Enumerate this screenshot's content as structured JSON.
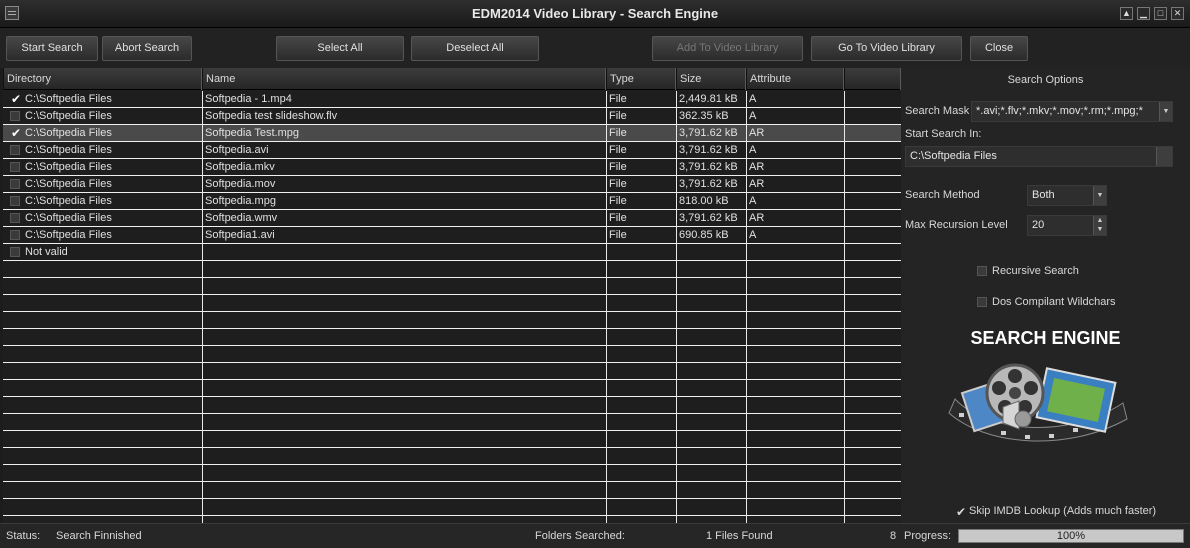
{
  "window": {
    "title": "EDM2014 Video Library -  Search Engine"
  },
  "toolbar": {
    "start_search": "Start Search",
    "abort_search": "Abort Search",
    "select_all": "Select All",
    "deselect_all": "Deselect All",
    "add_to_library": "Add To Video Library",
    "go_to_library": "Go To Video Library",
    "close": "Close"
  },
  "grid": {
    "columns": [
      "Directory",
      "Name",
      "Type",
      "Size",
      "Attribute"
    ],
    "rows": [
      {
        "checked": true,
        "dir": "C:\\Softpedia Files",
        "name": "Softpedia - 1.mp4",
        "type": "File",
        "size": "2,449.81 kB",
        "attr": "A",
        "selected": false
      },
      {
        "checked": false,
        "dir": "C:\\Softpedia Files",
        "name": "Softpedia test slideshow.flv",
        "type": "File",
        "size": "362.35 kB",
        "attr": "A",
        "selected": false
      },
      {
        "checked": true,
        "dir": "C:\\Softpedia Files",
        "name": "Softpedia Test.mpg",
        "type": "File",
        "size": "3,791.62 kB",
        "attr": "AR",
        "selected": true
      },
      {
        "checked": false,
        "dir": "C:\\Softpedia Files",
        "name": "Softpedia.avi",
        "type": "File",
        "size": "3,791.62 kB",
        "attr": "A",
        "selected": false
      },
      {
        "checked": false,
        "dir": "C:\\Softpedia Files",
        "name": "Softpedia.mkv",
        "type": "File",
        "size": "3,791.62 kB",
        "attr": "AR",
        "selected": false
      },
      {
        "checked": false,
        "dir": "C:\\Softpedia Files",
        "name": "Softpedia.mov",
        "type": "File",
        "size": "3,791.62 kB",
        "attr": "AR",
        "selected": false
      },
      {
        "checked": false,
        "dir": "C:\\Softpedia Files",
        "name": "Softpedia.mpg",
        "type": "File",
        "size": "818.00 kB",
        "attr": "A",
        "selected": false
      },
      {
        "checked": false,
        "dir": "C:\\Softpedia Files",
        "name": "Softpedia.wmv",
        "type": "File",
        "size": "3,791.62 kB",
        "attr": "AR",
        "selected": false
      },
      {
        "checked": false,
        "dir": "C:\\Softpedia Files",
        "name": "Softpedia1.avi",
        "type": "File",
        "size": "690.85 kB",
        "attr": "A",
        "selected": false
      },
      {
        "checked": false,
        "dir": "Not valid",
        "name": "",
        "type": "",
        "size": "",
        "attr": "",
        "selected": false
      }
    ]
  },
  "options": {
    "title": "Search Options",
    "search_mask_label": "Search Mask",
    "search_mask_value": "*.avi;*.flv;*.mkv;*.mov;*.rm;*.mpg;*",
    "start_in_label": "Start Search In:",
    "start_in_value": "C:\\Softpedia Files",
    "method_label": "Search Method",
    "method_value": "Both",
    "recursion_label": "Max Recursion Level",
    "recursion_value": "20",
    "recursive_label": "Recursive Search",
    "dos_label": "Dos Compilant Wildchars",
    "banner": "SEARCH ENGINE",
    "skip_imdb_label": "Skip IMDB Lookup (Adds much faster)"
  },
  "status": {
    "status_label": "Status:",
    "status_value": "Search Finnished",
    "folders_label": "Folders Searched:",
    "files_found": "1 Files Found",
    "count": "8",
    "progress_label": "Progress:",
    "progress_value": "100%"
  }
}
